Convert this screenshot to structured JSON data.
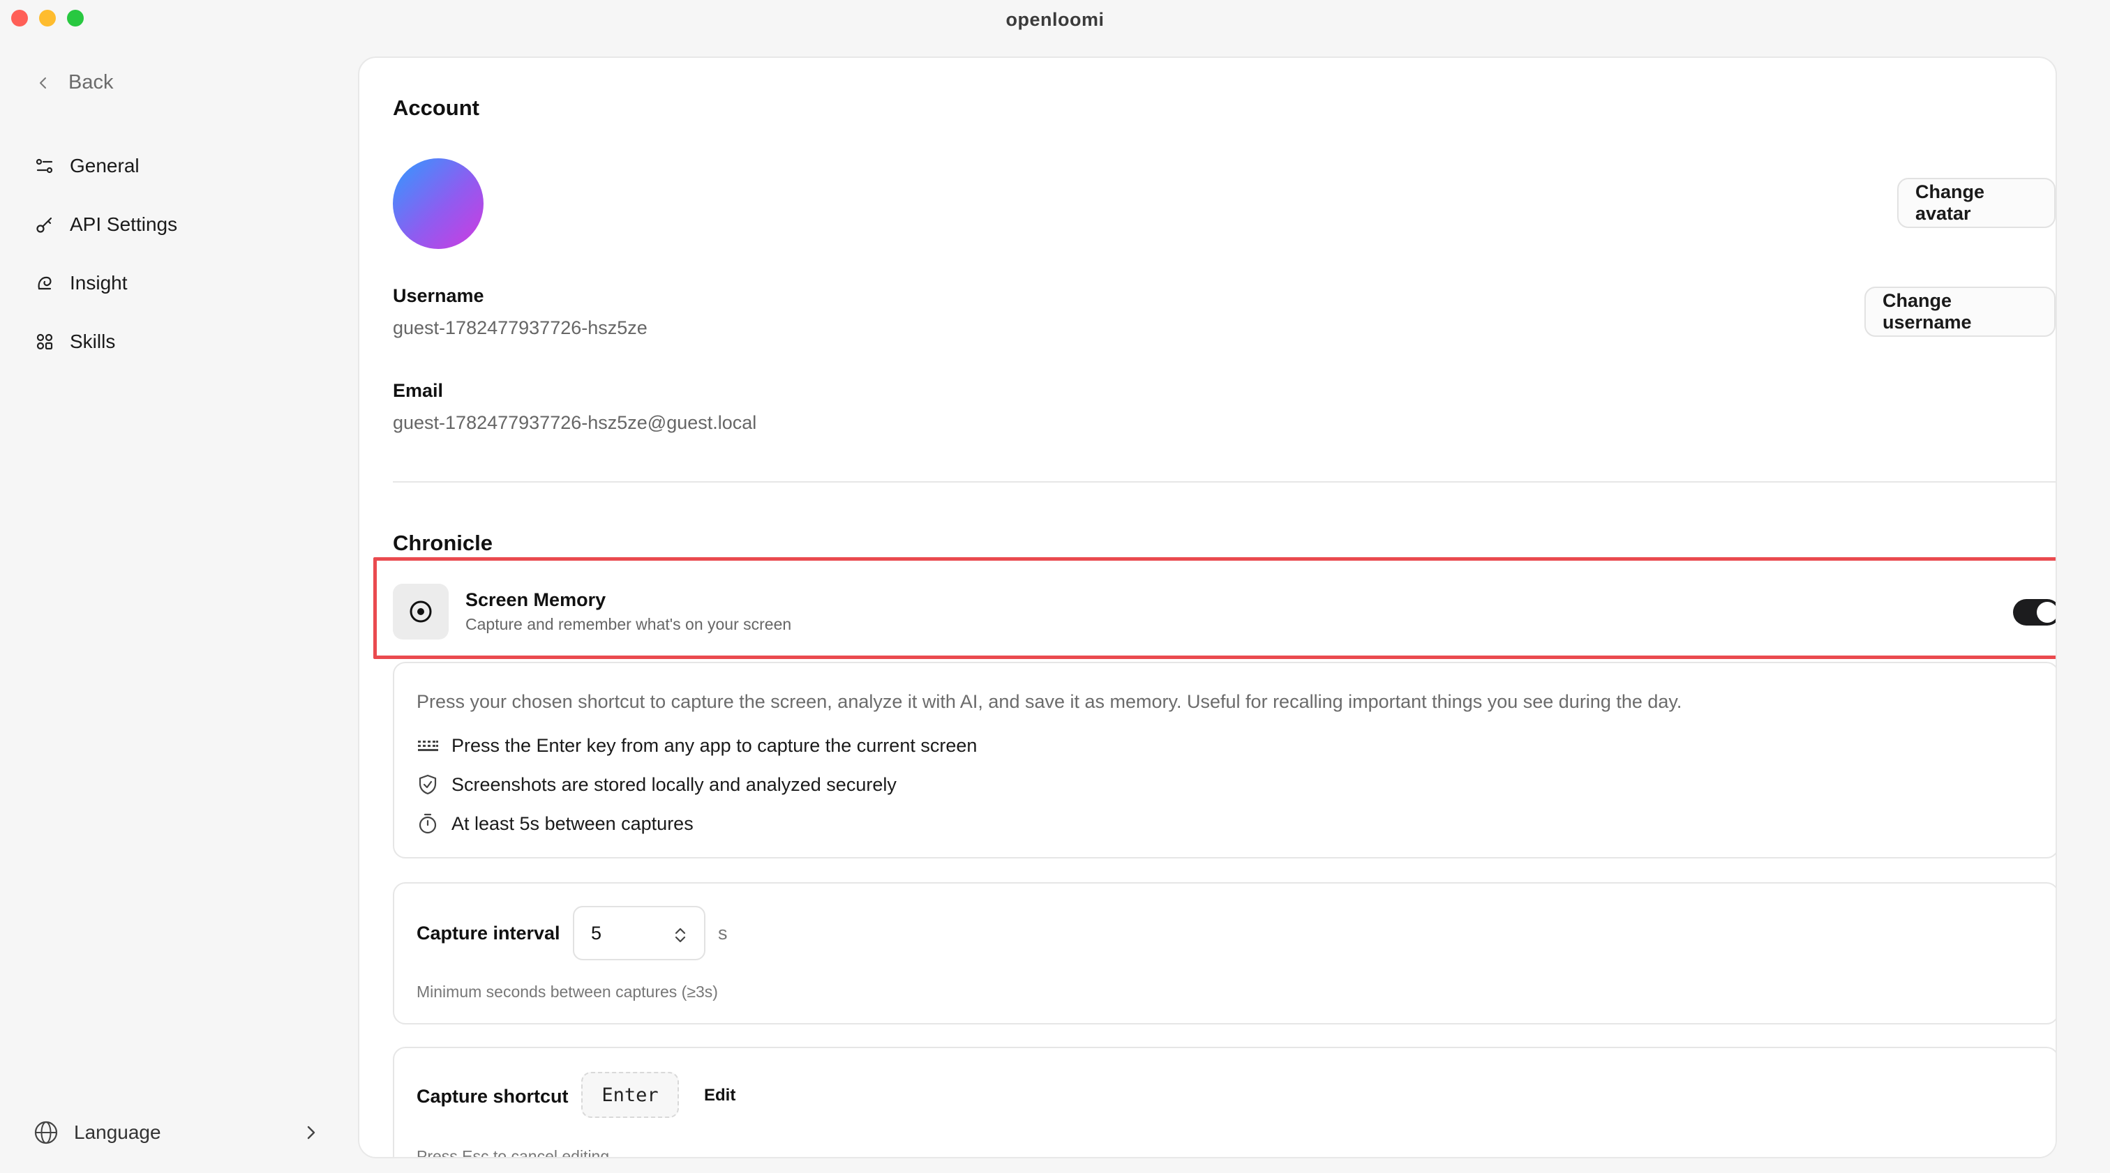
{
  "window": {
    "title": "openloomi"
  },
  "sidebar": {
    "back_label": "Back",
    "items": [
      {
        "label": "General",
        "icon": "sliders-icon"
      },
      {
        "label": "API Settings",
        "icon": "key-icon"
      },
      {
        "label": "Insight",
        "icon": "insight-icon"
      },
      {
        "label": "Skills",
        "icon": "grid-icon"
      }
    ],
    "language_label": "Language"
  },
  "account": {
    "section_title": "Account",
    "change_avatar_label": "Change avatar",
    "username_label": "Username",
    "username_value": "guest-1782477937726-hsz5ze",
    "change_username_label": "Change username",
    "email_label": "Email",
    "email_value": "guest-1782477937726-hsz5ze@guest.local"
  },
  "chronicle": {
    "section_title": "Chronicle",
    "screen_memory": {
      "title": "Screen Memory",
      "subtitle": "Capture and remember what's on your screen",
      "enabled": true
    },
    "info": {
      "description": "Press your chosen shortcut to capture the screen, analyze it with AI, and save it as memory. Useful for recalling important things you see during the day.",
      "bullets": [
        "Press the Enter key from any app to capture the current screen",
        "Screenshots are stored locally and analyzed securely",
        "At least 5s between captures"
      ]
    },
    "capture_interval": {
      "label": "Capture interval",
      "value": "5",
      "unit": "s",
      "hint": "Minimum seconds between captures (≥3s)"
    },
    "capture_shortcut": {
      "label": "Capture shortcut",
      "key": "Enter",
      "edit_label": "Edit",
      "hint": "Press Esc to cancel editing."
    }
  },
  "colors": {
    "highlight": "#ea4a4f",
    "toggle_on": "#1c1c1e"
  }
}
